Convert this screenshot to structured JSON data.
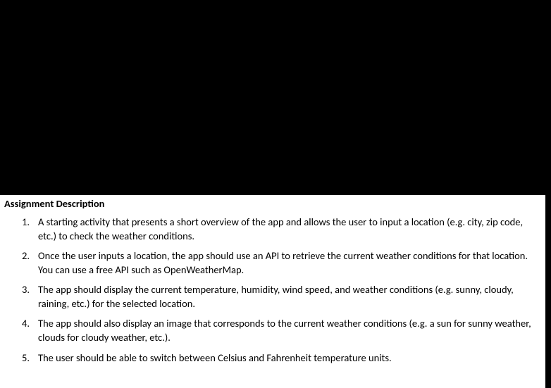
{
  "heading": "Assignment Description",
  "items": [
    {
      "number": "1.",
      "text": "A starting activity that presents a short overview of the app and allows the user to input a location (e.g. city, zip code, etc.) to check the weather conditions."
    },
    {
      "number": "2.",
      "text": "Once the user inputs a location, the app should use an API to retrieve the current weather conditions for that location. You can use a free API such as OpenWeatherMap."
    },
    {
      "number": "3.",
      "text": "The app should display the current temperature, humidity, wind speed, and weather conditions (e.g. sunny, cloudy, raining, etc.) for the selected location."
    },
    {
      "number": "4.",
      "text": "The app should also display an image that corresponds to the current weather conditions (e.g. a sun for sunny weather, clouds for cloudy weather, etc.)."
    },
    {
      "number": "5.",
      "text": "The user should be able to switch between Celsius and Fahrenheit temperature units."
    }
  ]
}
